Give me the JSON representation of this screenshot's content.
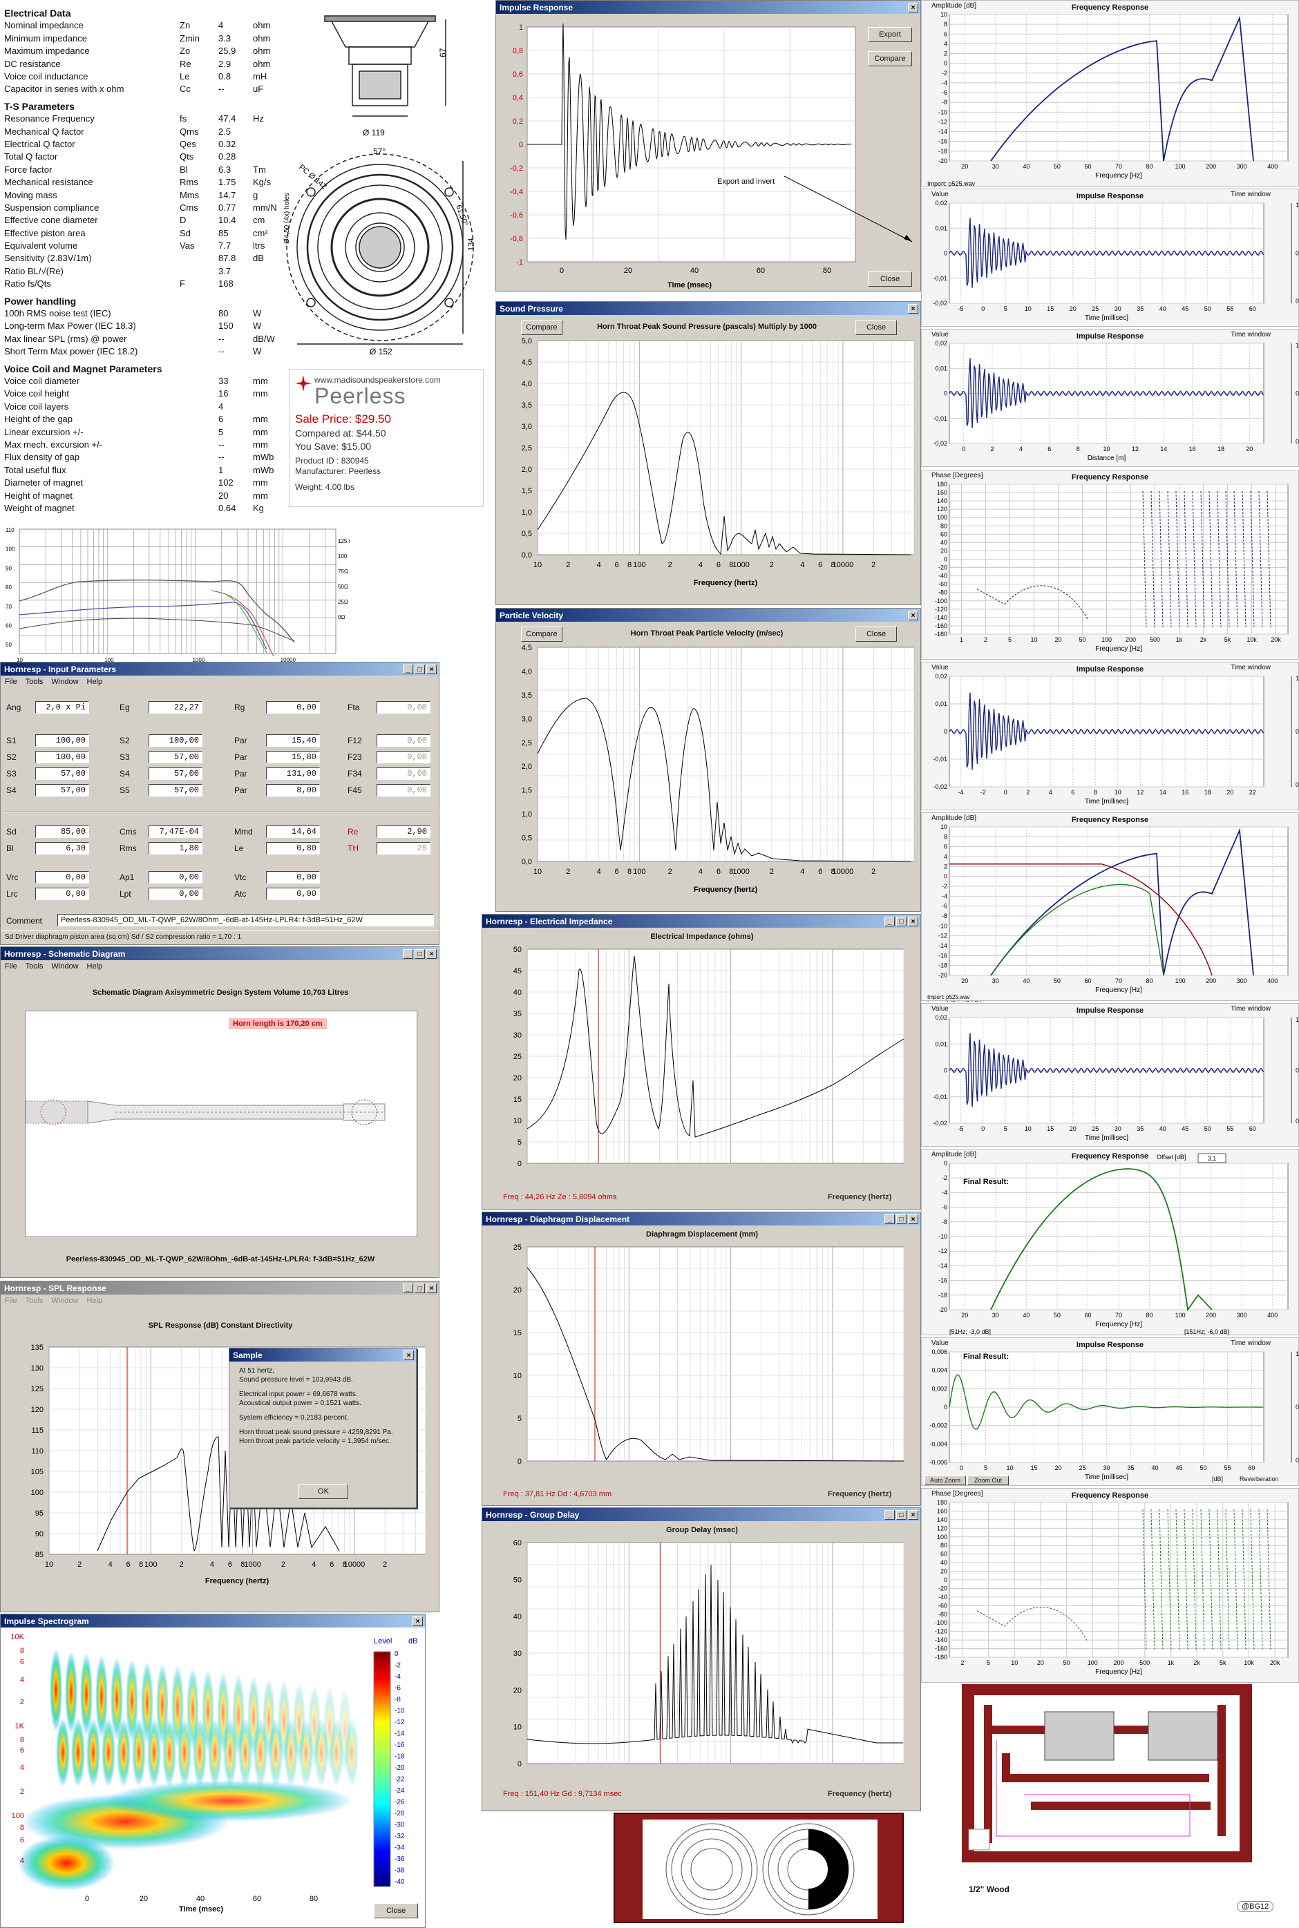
{
  "spec_sheet": {
    "sections": [
      {
        "title": "Electrical Data",
        "rows": [
          [
            "Nominal impedance",
            "Zn",
            "4",
            "ohm"
          ],
          [
            "Minimum impedance",
            "Zmin",
            "3.3",
            "ohm"
          ],
          [
            "Maximum impedance",
            "Zo",
            "25.9",
            "ohm"
          ],
          [
            "DC resistance",
            "Re",
            "2.9",
            "ohm"
          ],
          [
            "Voice coil inductance",
            "Le",
            "0.8",
            "mH"
          ],
          [
            "Capacitor in series with x ohm",
            "Cc",
            "--",
            "uF"
          ]
        ]
      },
      {
        "title": "T-S Parameters",
        "rows": [
          [
            "Resonance Frequency",
            "fs",
            "47.4",
            "Hz"
          ],
          [
            "Mechanical Q factor",
            "Qms",
            "2.5",
            ""
          ],
          [
            "Electrical Q factor",
            "Qes",
            "0.32",
            ""
          ],
          [
            "Total Q factor",
            "Qts",
            "0.28",
            ""
          ],
          [
            "Force factor",
            "Bl",
            "6.3",
            "Tm"
          ],
          [
            "Mechanical resistance",
            "Rms",
            "1.75",
            "Kg/s"
          ],
          [
            "Moving mass",
            "Mms",
            "14.7",
            "g"
          ],
          [
            "Suspension compliance",
            "Cms",
            "0.77",
            "mm/N"
          ],
          [
            "Effective cone diameter",
            "D",
            "10.4",
            "cm"
          ],
          [
            "Effective piston area",
            "Sd",
            "85",
            "cm²"
          ],
          [
            "Equivalent volume",
            "Vas",
            "7.7",
            "ltrs"
          ],
          [
            "Sensitivity (2.83V/1m)",
            "",
            "87.8",
            "dB"
          ],
          [
            "Ratio BL/√(Re)",
            "",
            "3.7",
            ""
          ],
          [
            "Ratio fs/Qts",
            "F",
            "168",
            ""
          ]
        ]
      },
      {
        "title": "Power handling",
        "rows": [
          [
            "100h RMS noise test (IEC)",
            "",
            "80",
            "W"
          ],
          [
            "Long-term Max Power (IEC 18.3)",
            "",
            "150",
            "W"
          ],
          [
            "Max linear SPL (rms) @ power",
            "",
            "--",
            "dB/W"
          ],
          [
            "Short Term Max power (IEC 18.2)",
            "",
            "--",
            "W"
          ]
        ]
      },
      {
        "title": "Voice Coil and Magnet Parameters",
        "rows": [
          [
            "Voice coil diameter",
            "",
            "33",
            "mm"
          ],
          [
            "Voice coil height",
            "",
            "16",
            "mm"
          ],
          [
            "Voice coil layers",
            "",
            "4",
            ""
          ],
          [
            "Height of the gap",
            "",
            "6",
            "mm"
          ],
          [
            "Linear excursion +/-",
            "",
            "5",
            "mm"
          ],
          [
            "Max mech. excursion +/-",
            "",
            "--",
            "mm"
          ],
          [
            "Flux density of gap",
            "",
            "--",
            "mWb"
          ],
          [
            "Total useful flux",
            "",
            "1",
            "mWb"
          ],
          [
            "Diameter of magnet",
            "",
            "102",
            "mm"
          ],
          [
            "Height of magnet",
            "",
            "20",
            "mm"
          ],
          [
            "Weight of magnet",
            "",
            "0.64",
            "Kg"
          ]
        ]
      }
    ]
  },
  "drawing": {
    "dim_119": "Ø 119",
    "dim_67": "67",
    "dim_152": "Ø 152",
    "dim_57": "57°",
    "dim_61": "61,50°",
    "dim_134": "134",
    "dim_pcd": "PC Ø 142",
    "dim_hole": "Ø4,50 (4x) holes"
  },
  "promo": {
    "url": "www.madisoundspeakerstore.com",
    "brand": "Peerless",
    "sale": "Sale Price: $29.50",
    "compared": "Compared at: $44.50",
    "save": "You Save: $15.00",
    "product_id": "Product ID : 830945",
    "manufacturer": "Manufacturer: Peerless",
    "weight": "Weight: 4.00 lbs"
  },
  "fr_chart": {
    "y_ticks": [
      "110",
      "100",
      "90",
      "80",
      "70",
      "60",
      "50"
    ],
    "x_ticks": [
      "10",
      "100",
      "1000",
      "10000",
      "40000"
    ],
    "r_ticks": [
      "125 Ω",
      "100",
      "75Ω",
      "50Ω",
      "25Ω",
      "0Ω"
    ]
  },
  "windows": {
    "impulse": {
      "title": "Impulse Response",
      "export": "Export",
      "compare": "Compare",
      "close": "Close",
      "annotation": "Export and invert",
      "xlabel": "Time (msec)",
      "y_ticks": [
        "1",
        "0,8",
        "0,6",
        "0,4",
        "0,2",
        "0",
        "-0,2",
        "-0,4",
        "-0,6",
        "-0,8",
        "-1"
      ],
      "x_ticks": [
        "0",
        "20",
        "40",
        "60",
        "80"
      ]
    },
    "sound_pressure": {
      "title": "Sound Pressure",
      "compare": "Compare",
      "close": "Close",
      "chart_title": "Horn Throat Peak Sound Pressure (pascals)   Multiply by 1000",
      "xlabel": "Frequency (hertz)",
      "y_ticks": [
        "5,0",
        "4,5",
        "4,0",
        "3,5",
        "3,0",
        "2,5",
        "2,0",
        "1,5",
        "1,0",
        "0,5",
        "0,0"
      ]
    },
    "particle_velocity": {
      "title": "Particle Velocity",
      "compare": "Compare",
      "close": "Close",
      "chart_title": "Horn Throat Peak Particle Velocity (m/sec)",
      "xlabel": "Frequency (hertz)",
      "y_ticks": [
        "4,5",
        "4,0",
        "3,5",
        "3,0",
        "2,5",
        "2,0",
        "1,5",
        "1,0",
        "0,5",
        "0,0"
      ]
    },
    "input_params": {
      "title": "Hornresp - Input Parameters",
      "menu": [
        "File",
        "Tools",
        "Window",
        "Help"
      ],
      "rows1": [
        [
          "Ang",
          "2,0 x Pi",
          "Eg",
          "22,27",
          "Rg",
          "0,00",
          "Fta",
          "0,00"
        ]
      ],
      "rows2": [
        [
          "S1",
          "100,00",
          "S2",
          "100,00",
          "Par",
          "15,40",
          "F12",
          "0,00"
        ],
        [
          "S2",
          "100,00",
          "S3",
          "57,00",
          "Par",
          "15,80",
          "F23",
          "0,00"
        ],
        [
          "S3",
          "57,00",
          "S4",
          "57,00",
          "Par",
          "131,00",
          "F34",
          "0,00"
        ],
        [
          "S4",
          "57,00",
          "S5",
          "57,00",
          "Par",
          "8,00",
          "F45",
          "0,00"
        ]
      ],
      "rows3": [
        [
          "Sd",
          "85,00",
          "Cms",
          "7,47E-04",
          "Mmd",
          "14,64",
          "Re",
          "2,90"
        ],
        [
          "Bl",
          "6,30",
          "Rms",
          "1,80",
          "Le",
          "0,80",
          "TH",
          "25"
        ]
      ],
      "rows4": [
        [
          "Vrc",
          "0,00",
          "Ap1",
          "0,00",
          "Vtc",
          "0,00"
        ],
        [
          "Lrc",
          "0,00",
          "Lpt",
          "0,00",
          "Atc",
          "0,00"
        ]
      ],
      "comment_label": "Comment",
      "comment": "Peerless-830945_OD_ML-T-QWP_62W/8Ohm_-6dB-at-145Hz-LPLR4: f-3dB=51Hz_62W",
      "status": "Sd  Driver diaphragm piston area (sq cm)   Sd / S2 compression ratio = 1,70 : 1"
    },
    "schematic": {
      "title": "Hornresp - Schematic Diagram",
      "menu": [
        "File",
        "Tools",
        "Window",
        "Help"
      ],
      "heading": "Schematic Diagram   Axisymmetric Design   System Volume 10,703 Litres",
      "badge": "Horn length is 170,20 cm",
      "caption": "Peerless-830945_OD_ML-T-QWP_62W/8Ohm_-6dB-at-145Hz-LPLR4: f-3dB=51Hz_62W"
    },
    "spl": {
      "title": "Hornresp - SPL Response",
      "menu": [
        "File",
        "Tools",
        "Window",
        "Help"
      ],
      "heading": "SPL Response (dB)   Constant Directivity",
      "xlabel": "Frequency (hertz)",
      "y_ticks": [
        "135",
        "130",
        "125",
        "120",
        "115",
        "110",
        "105",
        "100",
        "95",
        "90",
        "85"
      ]
    },
    "sample": {
      "title": "Sample",
      "lines": [
        "At 51 hertz,",
        "Sound pressure level = 103,9943 dB.",
        "Electrical input power = 69,6678 watts.",
        "Acoustical output power = 0,1521 watts.",
        "System efficiency = 0,2183 percent.",
        "Horn throat peak sound pressure = 4259,8291 Pa.",
        "Horn throat peak particle velocity = 1,3954 m/sec."
      ],
      "ok": "OK"
    },
    "spectrogram": {
      "title": "Impulse Spectrogram",
      "level": "Level",
      "db": "dB",
      "xlabel": "Time (msec)",
      "y_ticks": [
        "10K",
        "8",
        "6",
        "4",
        "2",
        "1K",
        "8",
        "6",
        "4",
        "2",
        "100",
        "8",
        "6",
        "4"
      ],
      "x_ticks": [
        "0",
        "20",
        "40",
        "60",
        "80"
      ],
      "scale": [
        "0",
        "-2",
        "-4",
        "-6",
        "-8",
        "-10",
        "-12",
        "-14",
        "-16",
        "-18",
        "-20",
        "-22",
        "-24",
        "-26",
        "-28",
        "-30",
        "-32",
        "-34",
        "-36",
        "-38",
        "-40"
      ],
      "close": "Close"
    },
    "impedance": {
      "title": "Hornresp - Electrical Impedance",
      "chart_title": "Electrical Impedance (ohms)",
      "xlabel": "Frequency (hertz)",
      "footer": "Freq : 44,26 Hz    Ze : 5,8094 ohms",
      "y_ticks": [
        "50",
        "45",
        "40",
        "35",
        "30",
        "25",
        "20",
        "15",
        "10",
        "5",
        "0"
      ]
    },
    "displacement": {
      "title": "Hornresp - Diaphragm Displacement",
      "chart_title": "Diaphragm Displacement (mm)",
      "xlabel": "Frequency (hertz)",
      "footer": "Freq : 37,81 Hz    Dd : 4,6703 mm",
      "y_ticks": [
        "25",
        "20",
        "15",
        "10",
        "5",
        "0"
      ]
    },
    "group_delay": {
      "title": "Hornresp - Group Delay",
      "chart_title": "Group Delay (msec)",
      "xlabel": "Frequency (hertz)",
      "footer": "Freq : 151,40 Hz    Gd : 9,7134 msec",
      "y_ticks": [
        "60",
        "50",
        "40",
        "30",
        "20",
        "10",
        "0"
      ]
    }
  },
  "freq_ticks": [
    "10",
    "2",
    "4",
    "6",
    "8",
    "100",
    "2",
    "4",
    "6",
    "8",
    "1000",
    "2",
    "4",
    "6",
    "8",
    "10000",
    "2"
  ],
  "right_panels": {
    "p1": {
      "amp": "Amplitude [dB]",
      "title": "Frequency Response",
      "xlabel": "Frequency [Hz]",
      "legend": "Import: p525.wav",
      "y": [
        "10",
        "8",
        "6",
        "4",
        "2",
        "0",
        "-2",
        "-4",
        "-6",
        "-8",
        "-10",
        "-12",
        "-14",
        "-16",
        "-18",
        "-20"
      ],
      "x": [
        "20",
        "30",
        "40",
        "50",
        "60",
        "70",
        "80",
        "100",
        "200",
        "300",
        "400"
      ]
    },
    "p2": {
      "value": "Value",
      "title": "Impulse Response",
      "tw": "Time window",
      "xlabel": "Time [millisec]",
      "y": [
        "0,02",
        "0,01",
        "0",
        "-0,01",
        "-0,02"
      ],
      "x": [
        "-5",
        "0",
        "5",
        "10",
        "15",
        "20",
        "25",
        "30",
        "35",
        "40",
        "45",
        "50",
        "55",
        "60"
      ]
    },
    "p3": {
      "value": "Value",
      "title": "Impulse Response",
      "tw": "Time window",
      "xlabel": "Distance [m]",
      "y": [
        "0,02",
        "0,01",
        "0",
        "-0,01",
        "-0,02"
      ],
      "x": [
        "0",
        "2",
        "4",
        "6",
        "8",
        "10",
        "12",
        "14",
        "16",
        "18",
        "20"
      ]
    },
    "p4": {
      "phase": "Phase [Degrees]",
      "title": "Frequency Response",
      "xlabel": "Frequency [Hz]",
      "y": [
        "180",
        "160",
        "140",
        "120",
        "100",
        "80",
        "60",
        "40",
        "20",
        "0",
        "-20",
        "-40",
        "-60",
        "-80",
        "-100",
        "-120",
        "-140",
        "-160",
        "-180"
      ],
      "x": [
        "1",
        "2",
        "5",
        "10",
        "20",
        "50",
        "100",
        "200",
        "500",
        "1k",
        "2k",
        "5k",
        "10k",
        "20k"
      ]
    },
    "p5": {
      "value": "Value",
      "title": "Impulse Response",
      "tw": "Time window",
      "xlabel": "Time [millisec]",
      "y": [
        "0,02",
        "0,01",
        "0",
        "-0,01",
        "-0,02"
      ],
      "x": [
        "-4",
        "-2",
        "0",
        "2",
        "4",
        "6",
        "8",
        "10",
        "12",
        "14",
        "16",
        "18",
        "20",
        "22"
      ]
    },
    "p6": {
      "amp": "Amplitude [dB]",
      "title": "Frequency Response",
      "xlabel": "Frequency [Hz]",
      "legend": [
        "Import: p525.wav",
        "Import: 145HzHP-LR4.txt",
        "(Import: p525.wav)*(Import: 145HzHP-LR4.txt)"
      ],
      "y": [
        "10",
        "8",
        "6",
        "4",
        "2",
        "0",
        "-2",
        "-4",
        "-6",
        "-8",
        "-10",
        "-12",
        "-14",
        "-16",
        "-18",
        "-20"
      ],
      "x": [
        "20",
        "30",
        "40",
        "50",
        "60",
        "70",
        "80",
        "100",
        "200",
        "300",
        "400"
      ]
    },
    "p7": {
      "value": "Value",
      "title": "Impulse Response",
      "tw": "Time window",
      "xlabel": "Time [millisec]",
      "y": [
        "0,02",
        "0,01",
        "0",
        "-0,01",
        "-0,02"
      ],
      "x": [
        "-5",
        "0",
        "5",
        "10",
        "15",
        "20",
        "25",
        "30",
        "35",
        "40",
        "45",
        "50",
        "55",
        "60"
      ]
    },
    "p8": {
      "amp": "Amplitude [dB]",
      "title": "Frequency Response",
      "offset": "Offset [dB]",
      "offset_val": "3,1",
      "final": "Final Result:",
      "xlabel": "Frequency [Hz]",
      "left": "[51Hz; -3,0 dB]",
      "right": "[151Hz; -6,0 dB]",
      "y": [
        "0",
        "-2",
        "-4",
        "-6",
        "-8",
        "-10",
        "-12",
        "-14",
        "-16",
        "-18",
        "-20"
      ],
      "x": [
        "20",
        "30",
        "40",
        "50",
        "60",
        "70",
        "80",
        "100",
        "200",
        "300",
        "400"
      ]
    },
    "p9": {
      "value": "Value",
      "final": "Final Result:",
      "title": "Impulse Response",
      "tw": "Time window",
      "xlabel": "Time [millisec]",
      "y": [
        "0,006",
        "0,004",
        "0,002",
        "0",
        "-0,002",
        "-0,004",
        "-0,006"
      ],
      "x": [
        "0",
        "5",
        "10",
        "15",
        "20",
        "25",
        "30",
        "35",
        "40",
        "45",
        "50",
        "55",
        "60"
      ],
      "auto_zoom": "Auto Zoom",
      "zoom_out": "Zoom Out",
      "db": "[dB]",
      "reverb": "Reverberation"
    },
    "p10": {
      "phase": "Phase [Degrees]",
      "title": "Frequency Response",
      "xlabel": "Frequency [Hz]",
      "y": [
        "180",
        "160",
        "140",
        "120",
        "100",
        "80",
        "60",
        "40",
        "20",
        "0",
        "-20",
        "-40",
        "-60",
        "-80",
        "-100",
        "-120",
        "-140",
        "-160",
        "-180"
      ],
      "x": [
        "2",
        "5",
        "10",
        "20",
        "50",
        "100",
        "200",
        "500",
        "1k",
        "2k",
        "5k",
        "10k",
        "20k"
      ]
    }
  },
  "cabinet": {
    "label": "1/2\" Wood",
    "badge": "@BG12"
  },
  "colors": {
    "title_bar": "#0a246a",
    "dialog": "#d4d0c8",
    "red": "#c00000",
    "navy": "#1a237e",
    "green": "#1b7a1b",
    "brown": "#8b1a1a"
  }
}
